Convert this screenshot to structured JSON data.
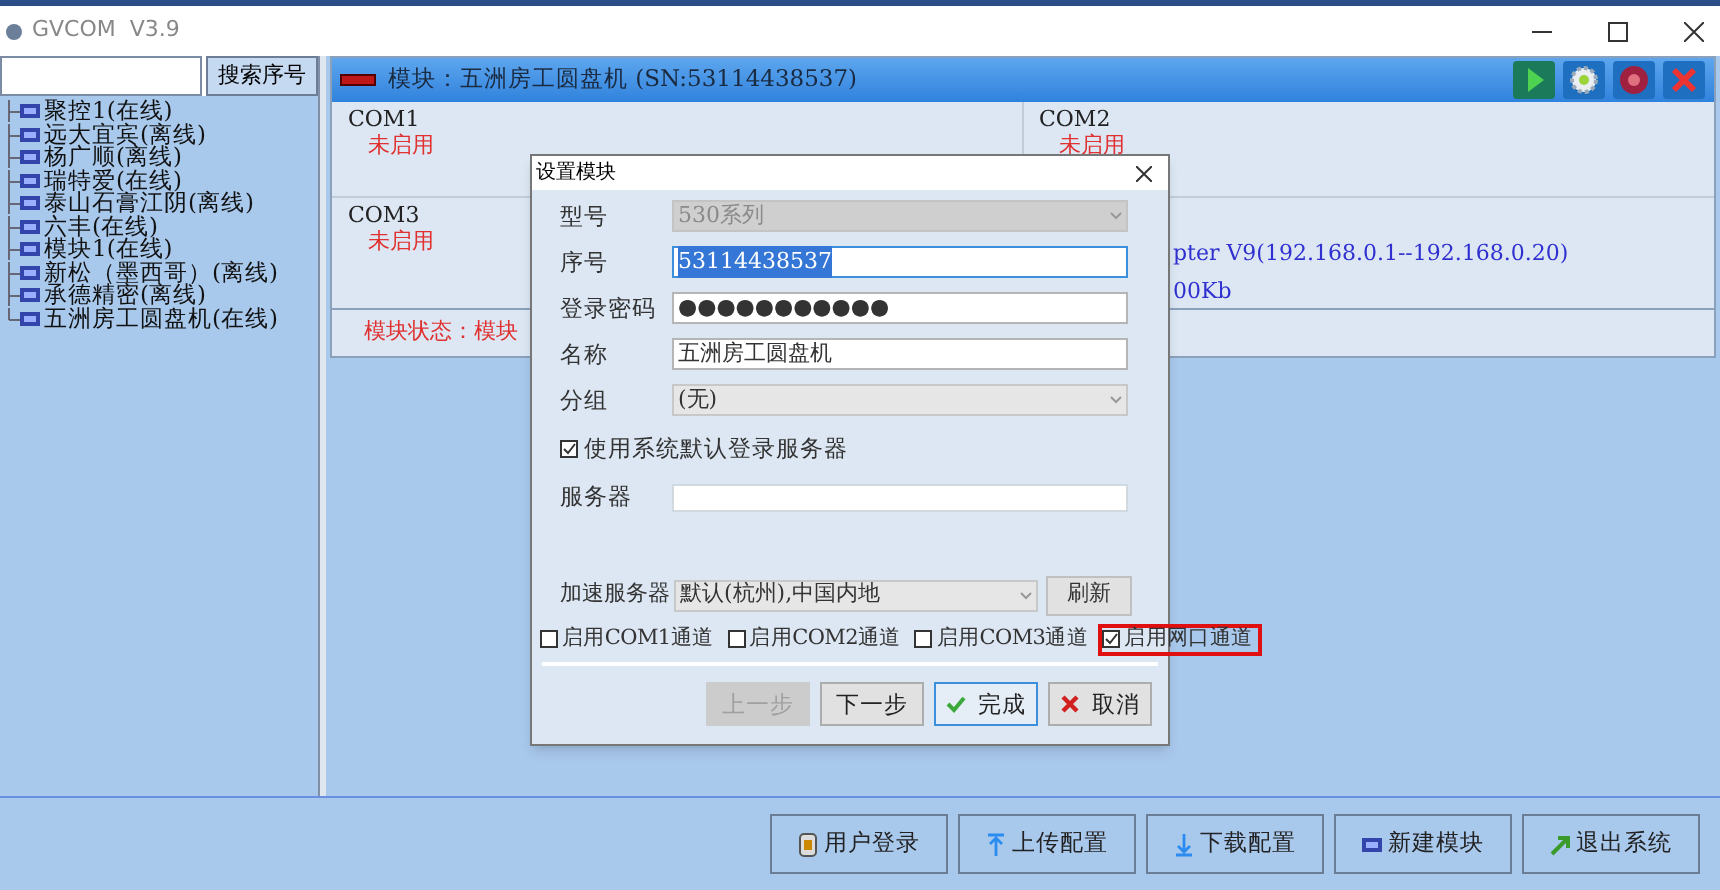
{
  "window": {
    "title": "GVCOM  V3.9"
  },
  "search": {
    "button": "搜索序号"
  },
  "devices": [
    {
      "label": "聚控1(在线)"
    },
    {
      "label": "远大宜宾(离线)"
    },
    {
      "label": "杨广顺(离线)"
    },
    {
      "label": "瑞特爱(在线)"
    },
    {
      "label": "泰山石膏江阴(离线)"
    },
    {
      "label": "六丰(在线)"
    },
    {
      "label": "模块1(在线)"
    },
    {
      "label": "新松（墨西哥）(离线)"
    },
    {
      "label": "承德精密(离线)"
    },
    {
      "label": "五洲房工圆盘机(在线)"
    }
  ],
  "module": {
    "title": "模块：五洲房工圆盘机 (SN:53114438537)",
    "ports": [
      {
        "name": "COM1",
        "status": "未启用"
      },
      {
        "name": "COM2",
        "status": "未启用"
      },
      {
        "name": "COM3",
        "status": "未启用"
      }
    ],
    "port_info": [
      "pter V9(192.168.0.1--192.168.0.20)",
      "00Kb"
    ],
    "status": "模块状态：模块"
  },
  "dialog": {
    "title": "设置模块",
    "fields": [
      {
        "kind": "select",
        "label": "型号",
        "value": "530系列",
        "disabled": true
      },
      {
        "kind": "text",
        "label": "序号",
        "value": "53114438537",
        "selected": true
      },
      {
        "kind": "text",
        "label": "登录密码",
        "value": "●●●●●●●●●●●",
        "selected": false
      },
      {
        "kind": "text",
        "label": "名称",
        "value": "五洲房工圆盘机",
        "selected": false
      },
      {
        "kind": "select",
        "label": "分组",
        "value": "(无)",
        "disabled": false
      }
    ],
    "default_server": {
      "label": "使用系统默认登录服务器",
      "checked": true
    },
    "server": {
      "label": "服务器"
    },
    "accel": {
      "label": "加速服务器",
      "value": "默认(杭州),中国内地",
      "button": "刷新"
    },
    "channels": [
      {
        "label": "启用COM1通道",
        "checked": false,
        "highlighted": false
      },
      {
        "label": "启用COM2通道",
        "checked": false,
        "highlighted": false
      },
      {
        "label": "启用COM3通道",
        "checked": false,
        "highlighted": false
      },
      {
        "label": "启用网口通道",
        "checked": true,
        "highlighted": true
      }
    ],
    "buttons": [
      {
        "kind": "prev",
        "label": "上一步",
        "disabled": true
      },
      {
        "kind": "next",
        "label": "下一步",
        "disabled": false
      },
      {
        "kind": "finish",
        "label": "完成",
        "disabled": false
      },
      {
        "kind": "cancel",
        "label": "取消",
        "disabled": false
      }
    ]
  },
  "toolbar": [
    {
      "kind": "login",
      "label": "用户登录"
    },
    {
      "kind": "upload",
      "label": "上传配置"
    },
    {
      "kind": "download",
      "label": "下载配置"
    },
    {
      "kind": "new",
      "label": "新建模块"
    },
    {
      "kind": "exit",
      "label": "退出系统"
    }
  ]
}
